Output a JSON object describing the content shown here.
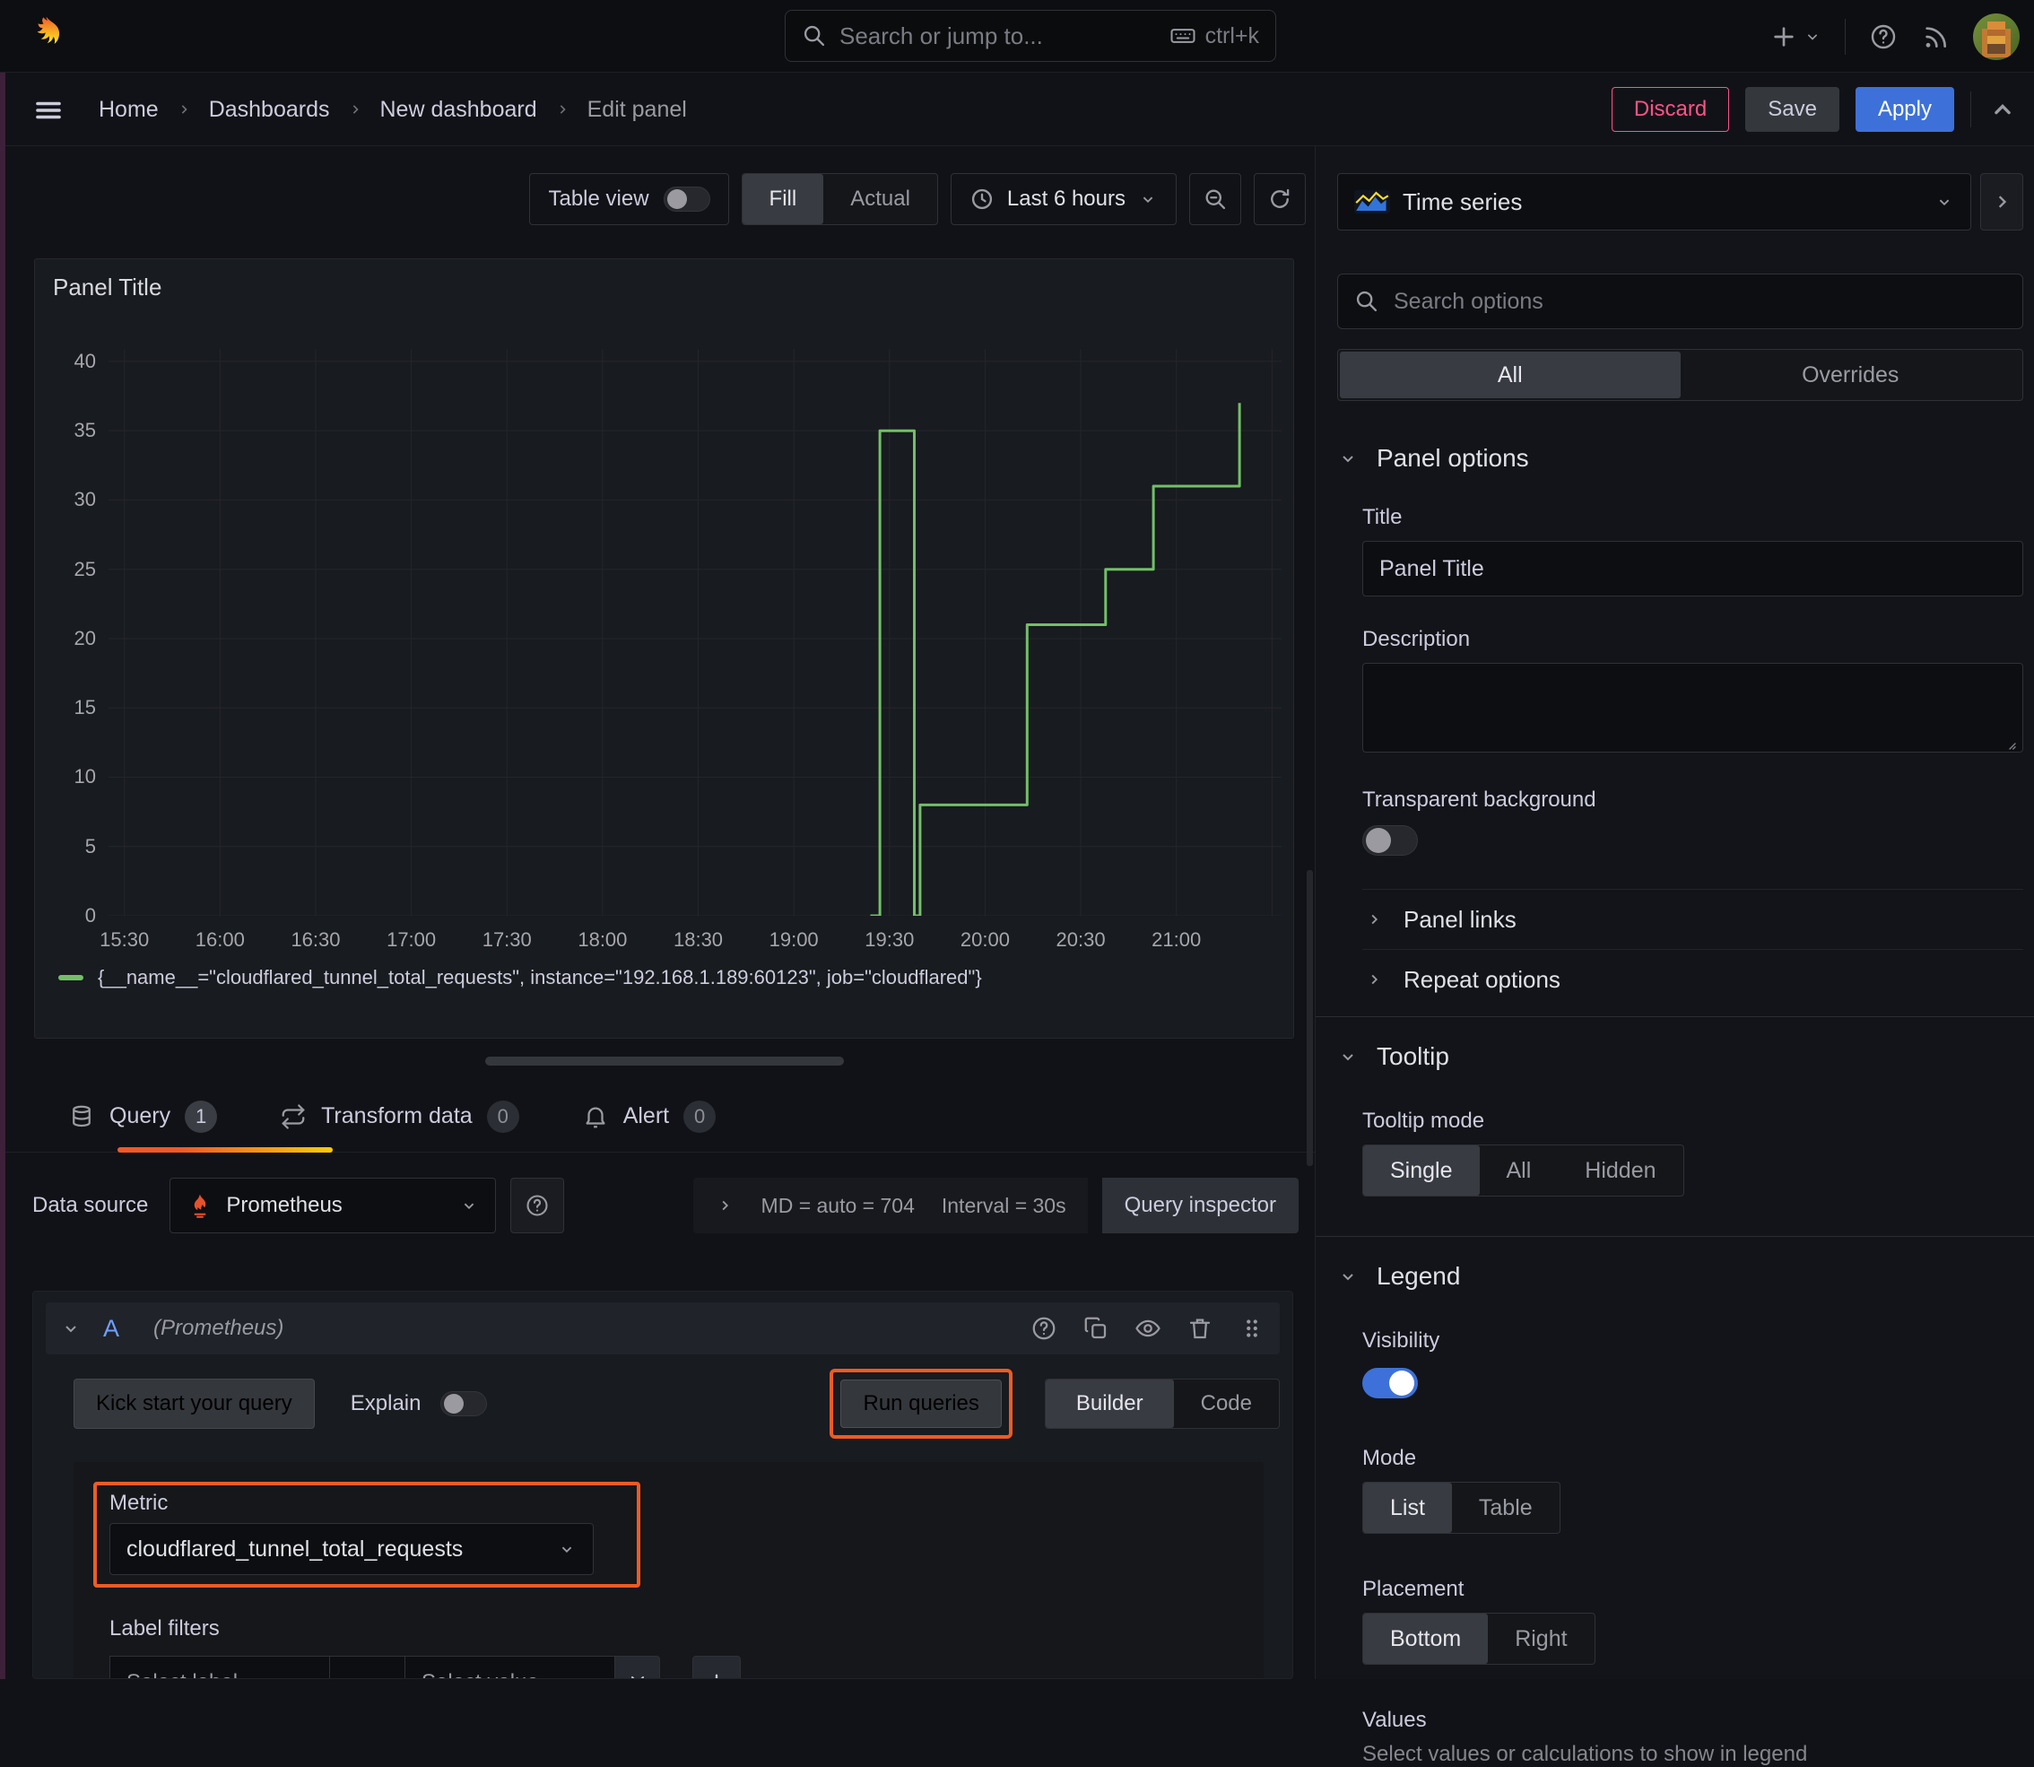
{
  "colors": {
    "accent_orange": "#ff780a",
    "annotation_orange": "#ee5b23",
    "series_green": "#73bf69",
    "apply_blue": "#3d71d9",
    "toggle_blue": "#3d71d9",
    "discard_pink": "#ff5286"
  },
  "topnav": {
    "search_placeholder": "Search or jump to...",
    "shortcut": "ctrl+k"
  },
  "breadcrumb": {
    "items": [
      "Home",
      "Dashboards",
      "New dashboard",
      "Edit panel"
    ]
  },
  "actions": {
    "discard": "Discard",
    "save": "Save",
    "apply": "Apply"
  },
  "toolbar": {
    "table_view": "Table view",
    "fill": "Fill",
    "actual": "Actual",
    "time_range": "Last 6 hours"
  },
  "panel": {
    "title": "Panel Title",
    "legend_text": "{__name__=\"cloudflared_tunnel_total_requests\", instance=\"192.168.1.189:60123\", job=\"cloudflared\"}"
  },
  "chart_data": {
    "type": "line",
    "step": true,
    "title": "Panel Title",
    "grid": true,
    "legend_position": "bottom",
    "x_range": [
      15.417,
      21.55
    ],
    "y_range": [
      0,
      40.9
    ],
    "y_ticks": [
      0,
      5,
      10,
      15,
      20,
      25,
      30,
      35,
      40
    ],
    "x_ticks": [
      {
        "t": 15.5,
        "label": "15:30"
      },
      {
        "t": 16.0,
        "label": "16:00"
      },
      {
        "t": 16.5,
        "label": "16:30"
      },
      {
        "t": 17.0,
        "label": "17:00"
      },
      {
        "t": 17.5,
        "label": "17:30"
      },
      {
        "t": 18.0,
        "label": "18:00"
      },
      {
        "t": 18.5,
        "label": "18:30"
      },
      {
        "t": 19.0,
        "label": "19:00"
      },
      {
        "t": 19.5,
        "label": "19:30"
      },
      {
        "t": 20.0,
        "label": "20:00"
      },
      {
        "t": 20.5,
        "label": "20:30"
      },
      {
        "t": 21.0,
        "label": "21:00"
      },
      {
        "t": 21.5,
        "label": ""
      }
    ],
    "series": [
      {
        "name": "{__name__=\"cloudflared_tunnel_total_requests\", instance=\"192.168.1.189:60123\", job=\"cloudflared\"}",
        "color": "#73bf69",
        "points": [
          [
            19.4,
            0
          ],
          [
            19.45,
            0
          ],
          [
            19.45,
            35
          ],
          [
            19.63,
            35
          ],
          [
            19.63,
            0
          ],
          [
            19.66,
            0
          ],
          [
            19.66,
            8
          ],
          [
            20.22,
            8
          ],
          [
            20.22,
            21
          ],
          [
            20.63,
            21
          ],
          [
            20.63,
            25
          ],
          [
            20.88,
            25
          ],
          [
            20.88,
            31
          ],
          [
            21.33,
            31
          ],
          [
            21.33,
            37
          ]
        ]
      }
    ]
  },
  "query_section": {
    "tabs": [
      {
        "label": "Query",
        "count": "1"
      },
      {
        "label": "Transform data",
        "count": "0"
      },
      {
        "label": "Alert",
        "count": "0"
      }
    ],
    "datasource": {
      "label": "Data source",
      "value": "Prometheus",
      "stats_md": "MD = auto = 704",
      "stats_interval": "Interval = 30s",
      "inspector": "Query inspector"
    },
    "editor": {
      "ref_id": "A",
      "ds_hint": "(Prometheus)",
      "kickstart": "Kick start your query",
      "explain": "Explain",
      "run": "Run queries",
      "builder": "Builder",
      "code": "Code",
      "metric_label": "Metric",
      "metric_value": "cloudflared_tunnel_total_requests",
      "label_filters_label": "Label filters",
      "select_label": "Select label",
      "operator": "=",
      "select_value": "Select value"
    }
  },
  "options": {
    "visualization": "Time series",
    "search_placeholder": "Search options",
    "tabs": {
      "all": "All",
      "overrides": "Overrides"
    },
    "panel_options": {
      "heading": "Panel options",
      "title_label": "Title",
      "title_value": "Panel Title",
      "description_label": "Description",
      "transparent_label": "Transparent background"
    },
    "links": {
      "panel_links": "Panel links",
      "repeat_options": "Repeat options"
    },
    "tooltip": {
      "heading": "Tooltip",
      "mode_label": "Tooltip mode",
      "modes": [
        "Single",
        "All",
        "Hidden"
      ],
      "selected": "Single"
    },
    "legend": {
      "heading": "Legend",
      "visibility_label": "Visibility",
      "mode_label": "Mode",
      "modes": [
        "List",
        "Table"
      ],
      "selected_mode": "List",
      "placement_label": "Placement",
      "placements": [
        "Bottom",
        "Right"
      ],
      "selected_placement": "Bottom",
      "values_label": "Values",
      "values_desc": "Select values or calculations to show in legend"
    }
  }
}
